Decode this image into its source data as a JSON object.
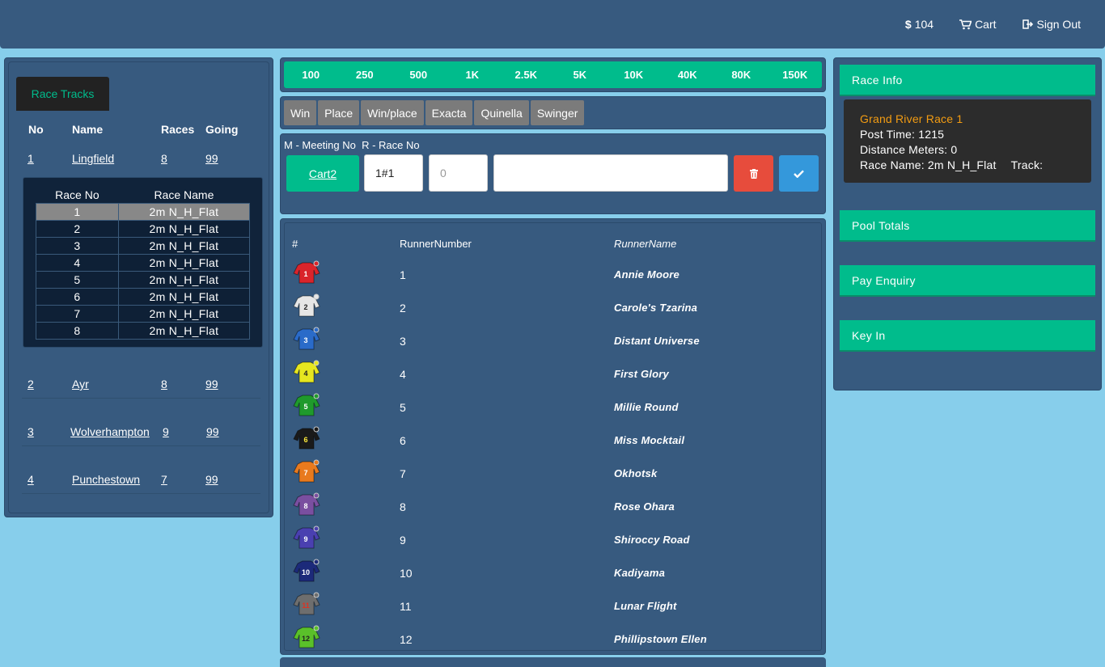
{
  "topnav": {
    "balance": "104",
    "cart": "Cart",
    "sign_out": "Sign Out"
  },
  "tracks": {
    "tab_label": "Race Tracks",
    "headers": {
      "no": "No",
      "name": "Name",
      "races": "Races",
      "going": "Going"
    },
    "items": [
      {
        "no": "1",
        "name": "Lingfield",
        "races": "8",
        "going": "99"
      },
      {
        "no": "2",
        "name": "Ayr",
        "races": "8",
        "going": "99"
      },
      {
        "no": "3",
        "name": "Wolverhampton",
        "races": "9",
        "going": "99"
      },
      {
        "no": "4",
        "name": "Punchestown",
        "races": "7",
        "going": "99"
      }
    ],
    "race_table": {
      "headers": {
        "race_no": "Race No",
        "race_name": "Race Name"
      },
      "rows": [
        {
          "no": "1",
          "name": "2m N_H_Flat"
        },
        {
          "no": "2",
          "name": "2m N_H_Flat"
        },
        {
          "no": "3",
          "name": "2m N_H_Flat"
        },
        {
          "no": "4",
          "name": "2m N_H_Flat"
        },
        {
          "no": "5",
          "name": "2m N_H_Flat"
        },
        {
          "no": "6",
          "name": "2m N_H_Flat"
        },
        {
          "no": "7",
          "name": "2m N_H_Flat"
        },
        {
          "no": "8",
          "name": "2m N_H_Flat"
        }
      ]
    }
  },
  "stakes": [
    "100",
    "250",
    "500",
    "1K",
    "2.5K",
    "5K",
    "10K",
    "40K",
    "80K",
    "150K"
  ],
  "bet_types": [
    "Win",
    "Place",
    "Win/place",
    "Exacta",
    "Quinella",
    "Swinger"
  ],
  "entry": {
    "label": "M - Meeting No  R - Race No",
    "cart_button": "Cart2",
    "meeting_race_value": "1#1",
    "amount_placeholder": "0",
    "selection_value": ""
  },
  "runners": {
    "headers": {
      "num": "#",
      "runner_number": "RunnerNumber",
      "runner_name": "RunnerName"
    },
    "rows": [
      {
        "number": "1",
        "name": "Annie Moore",
        "silk": "#d9242b"
      },
      {
        "number": "2",
        "name": "Carole's Tzarina",
        "silk": "#e6e6e6"
      },
      {
        "number": "3",
        "name": "Distant Universe",
        "silk": "#2a6bc9"
      },
      {
        "number": "4",
        "name": "First Glory",
        "silk": "#e6e620"
      },
      {
        "number": "5",
        "name": "Millie Round",
        "silk": "#1f9a2c"
      },
      {
        "number": "6",
        "name": "Miss Mocktail",
        "silk": "#1a1a1a"
      },
      {
        "number": "7",
        "name": "Okhotsk",
        "silk": "#e87a1e"
      },
      {
        "number": "8",
        "name": "Rose Ohara",
        "silk": "#7a4fa0"
      },
      {
        "number": "9",
        "name": "Shiroccy Road",
        "silk": "#4a40b0"
      },
      {
        "number": "10",
        "name": "Kadiyama",
        "silk": "#1c2a7a"
      },
      {
        "number": "11",
        "name": "Lunar Flight",
        "silk": "#6e6e6e"
      },
      {
        "number": "12",
        "name": "Phillipstown Ellen",
        "silk": "#5ac02a"
      }
    ]
  },
  "race_info": {
    "title": "Race Info",
    "race_title": "Grand River Race 1",
    "post_time": "Post Time: 1215",
    "distance": "Distance Meters: 0",
    "race_name": "Race Name: 2m N_H_Flat",
    "track": "Track:"
  },
  "sections": {
    "pool_totals": "Pool Totals",
    "pay_enquiry": "Pay Enquiry",
    "key_in": "Key In"
  },
  "colors": {
    "accent": "#00bc8c",
    "panel": "#375a7f",
    "page_bg": "#87ceeb",
    "delete": "#e74c3c",
    "confirm": "#3498db",
    "race_title": "#f39c12"
  }
}
